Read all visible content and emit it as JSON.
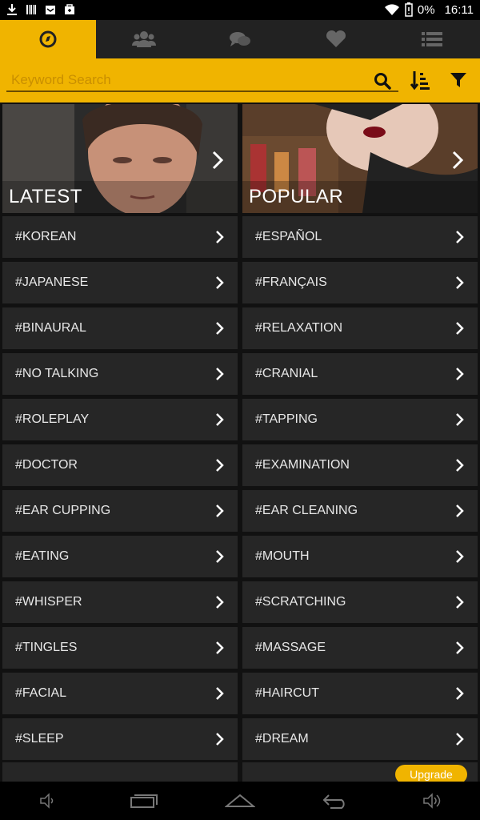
{
  "status": {
    "battery": "0%",
    "time": "16:11"
  },
  "tabs": [
    {
      "icon": "compass-icon"
    },
    {
      "icon": "group-icon"
    },
    {
      "icon": "chat-icon"
    },
    {
      "icon": "heart-icon"
    },
    {
      "icon": "list-icon"
    }
  ],
  "search": {
    "placeholder": "Keyword Search",
    "value": ""
  },
  "heroes": [
    {
      "label": "LATEST"
    },
    {
      "label": "POPULAR"
    }
  ],
  "tags_left": [
    "#KOREAN",
    "#JAPANESE",
    "#BINAURAL",
    "#NO TALKING",
    "#ROLEPLAY",
    "#DOCTOR",
    "#EAR CUPPING",
    "#EATING",
    "#WHISPER",
    "#TINGLES",
    "#FACIAL",
    "#SLEEP"
  ],
  "tags_right": [
    "#ESPAÑOL",
    "#FRANÇAIS",
    "#RELAXATION",
    "#CRANIAL",
    "#TAPPING",
    "#EXAMINATION",
    "#EAR CLEANING",
    "#MOUTH",
    "#SCRATCHING",
    "#MASSAGE",
    "#HAIRCUT",
    "#DREAM"
  ],
  "upgrade_label": "Upgrade",
  "colors": {
    "accent": "#f0b400",
    "tile": "#262626"
  }
}
